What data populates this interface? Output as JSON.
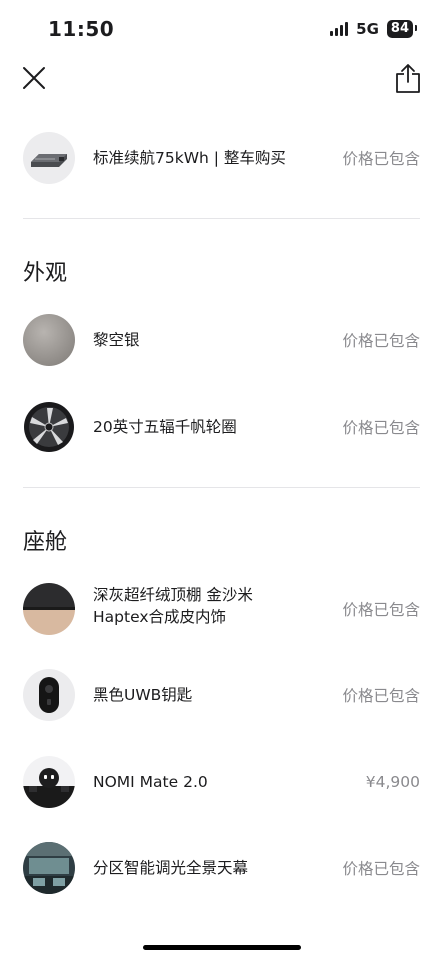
{
  "status_bar": {
    "time": "11:50",
    "network": "5G",
    "battery": "84"
  },
  "header": {
    "close_icon": "close-icon",
    "share_icon": "share-icon"
  },
  "battery_item": {
    "label": "标准续航75kWh | 整车购买",
    "price": "价格已包含"
  },
  "exterior": {
    "title": "外观",
    "items": [
      {
        "label": "黎空银",
        "price": "价格已包含"
      },
      {
        "label": "20英寸五辐千帆轮圈",
        "price": "价格已包含"
      }
    ]
  },
  "cabin": {
    "title": "座舱",
    "items": [
      {
        "label_line1": "深灰超纤绒顶棚 金沙米",
        "label_line2": "Haptex合成皮内饰",
        "price": "价格已包含"
      },
      {
        "label": "黑色UWB钥匙",
        "price": "价格已包含"
      },
      {
        "label": "NOMI Mate 2.0",
        "price": "¥4,900"
      },
      {
        "label": "分区智能调光全景天幕",
        "price": "价格已包含"
      }
    ]
  },
  "colors": {
    "text_primary": "#1c1c1e",
    "text_secondary": "#8a8a8e",
    "divider": "#e5e5e8"
  }
}
